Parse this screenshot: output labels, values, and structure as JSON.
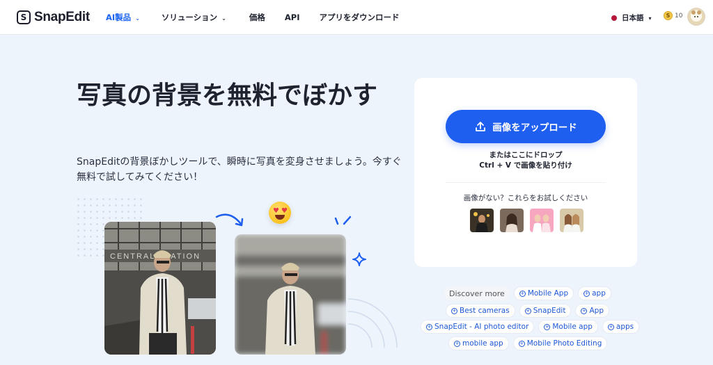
{
  "header": {
    "logo_text": "SnapEdit",
    "logo_mark": "S",
    "nav": [
      {
        "label": "AI製品",
        "active": true
      },
      {
        "label": "ソリューション",
        "active": false
      },
      {
        "label": "価格",
        "active": false
      },
      {
        "label": "API",
        "active": false
      },
      {
        "label": "アプリをダウンロード",
        "active": false
      }
    ],
    "language": "日本語",
    "coin_count": "10",
    "coin_symbol": "S"
  },
  "hero": {
    "title": "写真の背景を無料でぼかす",
    "subtitle": "SnapEditの背景ぼかしツールで、瞬時に写真を変身させましょう。今すぐ無料で試してみてください！"
  },
  "upload": {
    "button_label": "画像をアップロード",
    "drop_line1": "またはここにドロップ",
    "drop_line2": "Ctrl + V で画像を貼り付け",
    "no_image_text": "画像がない？これらをお試しください",
    "samples": [
      "sample-1",
      "sample-2",
      "sample-3",
      "sample-4"
    ]
  },
  "discover": {
    "label": "Discover more",
    "chips": [
      "Mobile App",
      "app",
      "Best cameras",
      "SnapEdit",
      "App",
      "SnapEdit - AI photo editor",
      "Mobile app",
      "apps",
      "mobile app",
      "Mobile Photo Editing"
    ]
  },
  "colors": {
    "accent": "#1f5ff0",
    "nav_active": "#1c64f2",
    "background": "#eef4fc"
  },
  "icons": [
    "upload-icon",
    "chevron-down-icon",
    "plus-circle-icon",
    "heart-eyes-emoji",
    "sparkle-icon",
    "arrow-icon"
  ]
}
